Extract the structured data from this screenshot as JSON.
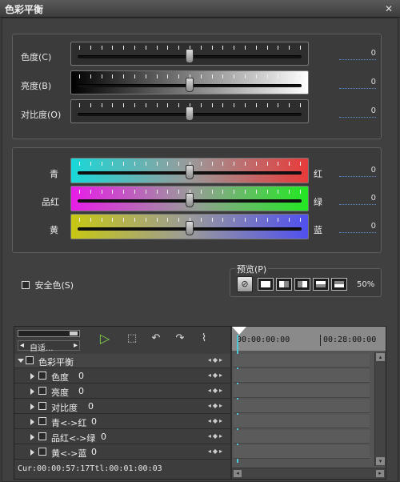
{
  "window": {
    "title": "色彩平衡"
  },
  "basic": {
    "rows": [
      {
        "label": "色度(C)",
        "value": "0"
      },
      {
        "label": "亮度(B)",
        "value": "0"
      },
      {
        "label": "对比度(O)",
        "value": "0"
      }
    ]
  },
  "color": {
    "rows": [
      {
        "left": "青",
        "right": "红",
        "value": "0"
      },
      {
        "left": "品红",
        "right": "绿",
        "value": "0"
      },
      {
        "left": "黄",
        "right": "蓝",
        "value": "0"
      }
    ]
  },
  "safe_color": {
    "label": "安全色(S)"
  },
  "preview": {
    "label": "预览(P)",
    "zoom": "50%"
  },
  "timeline": {
    "mode": "自适...",
    "times": [
      "00:00:00:00",
      "00:28:00:00"
    ],
    "tracks": [
      {
        "label": "色彩平衡"
      },
      {
        "label": "色度",
        "value": "0"
      },
      {
        "label": "亮度",
        "value": "0"
      },
      {
        "label": "对比度",
        "value": "0"
      },
      {
        "label": "青<->红",
        "value": "0"
      },
      {
        "label": "品红<->绿",
        "value": "0"
      },
      {
        "label": "黄<->蓝",
        "value": "0"
      }
    ],
    "status": "Cur:00:00:57:17Ttl:00:01:00:03"
  },
  "colors": {
    "accent_value_line": "#5b8fd0",
    "playhead": "#4cc7d8"
  }
}
